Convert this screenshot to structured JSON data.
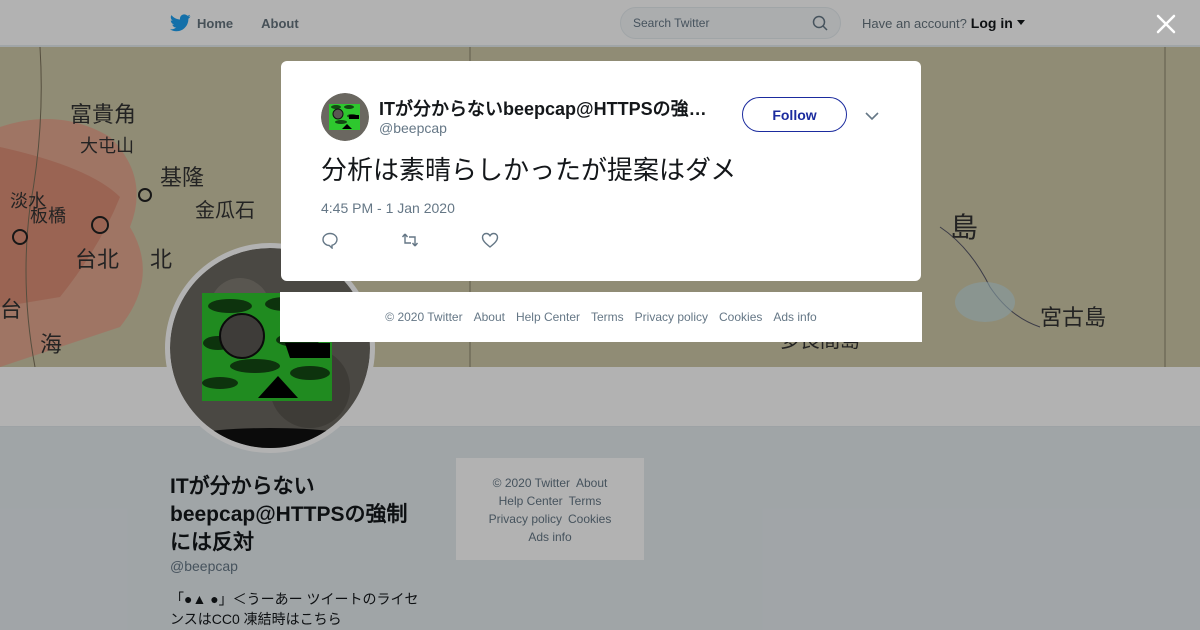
{
  "header": {
    "home_label": "Home",
    "about_label": "About",
    "search_placeholder": "Search Twitter",
    "account_prompt": "Have an account?",
    "login_label": "Log in"
  },
  "profile": {
    "name": "ITが分からないbeepcap@HTTPSの強制には反対",
    "handle": "@beepcap",
    "bio": "「●▲ ●」＜うーあー ツイートのライセンスはCC0 凍結時はこちら"
  },
  "banner_map_labels": [
    "富貴角",
    "大屯山",
    "基隆",
    "金瓜石",
    "淡水",
    "板橋",
    "台北",
    "台",
    "海",
    "北",
    "宮古島",
    "島",
    "多良間島"
  ],
  "side_footer": {
    "links": [
      "© 2020 Twitter",
      "About",
      "Help Center",
      "Terms",
      "Privacy policy",
      "Cookies",
      "Ads info"
    ]
  },
  "tweet": {
    "author_name": "ITが分からないbeepcap@HTTPSの強制には反対",
    "author_handle": "@beepcap",
    "follow_label": "Follow",
    "text": "分析は素晴らしかったが提案はダメ",
    "timestamp": "4:45 PM - 1 Jan 2020"
  },
  "modal_footer": {
    "links": [
      "© 2020 Twitter",
      "About",
      "Help Center",
      "Terms",
      "Privacy policy",
      "Cookies",
      "Ads info"
    ]
  },
  "colors": {
    "brand": "#1da1f2",
    "follow_border": "#1b2b9e",
    "text_secondary": "#657786"
  },
  "icons": [
    "twitter-bird-icon",
    "search-icon",
    "caret-down-icon",
    "close-icon",
    "chevron-down-icon",
    "reply-icon",
    "retweet-icon",
    "like-icon"
  ]
}
